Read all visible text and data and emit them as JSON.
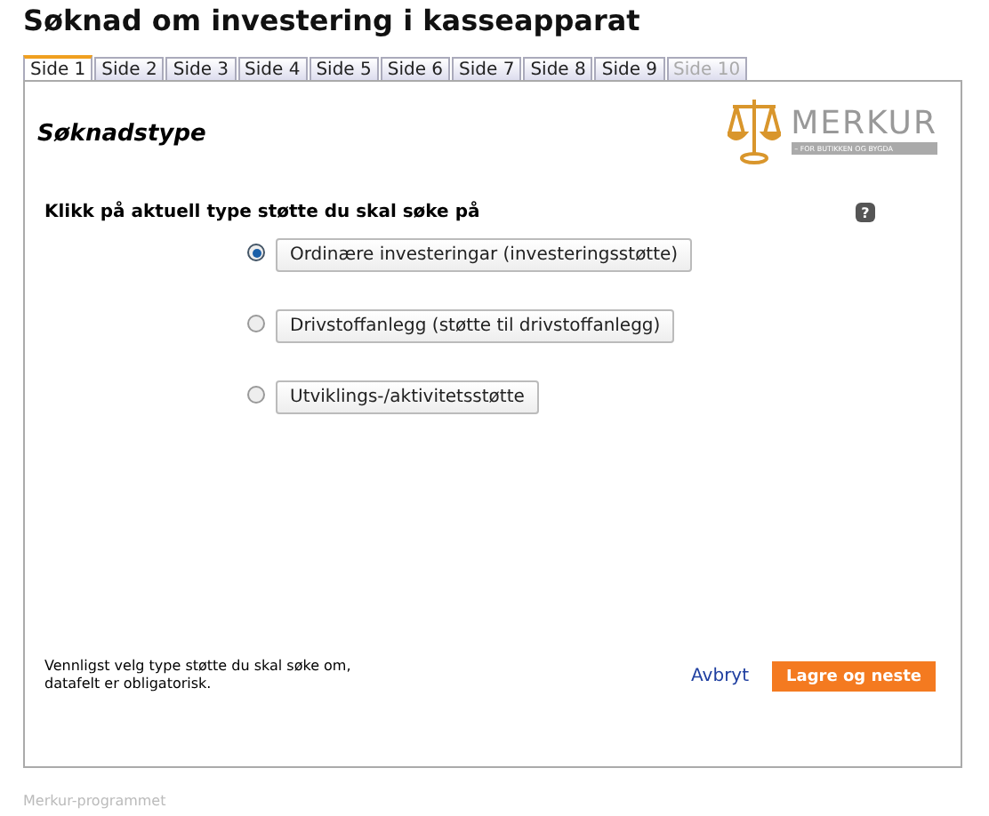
{
  "title": "Søknad om investering i kasseapparat",
  "tabs": [
    {
      "label": "Side 1",
      "selected": true,
      "disabled": false
    },
    {
      "label": "Side 2",
      "selected": false,
      "disabled": false
    },
    {
      "label": "Side 3",
      "selected": false,
      "disabled": false
    },
    {
      "label": "Side 4",
      "selected": false,
      "disabled": false
    },
    {
      "label": "Side 5",
      "selected": false,
      "disabled": false
    },
    {
      "label": "Side 6",
      "selected": false,
      "disabled": false
    },
    {
      "label": "Side 7",
      "selected": false,
      "disabled": false
    },
    {
      "label": "Side 8",
      "selected": false,
      "disabled": false
    },
    {
      "label": "Side 9",
      "selected": false,
      "disabled": false
    },
    {
      "label": "Side 10",
      "selected": false,
      "disabled": true
    }
  ],
  "section_title": "Søknadstype",
  "logo": {
    "name": "MERKUR",
    "tagline": "– FOR BUTIKKEN OG BYGDA"
  },
  "question": "Klikk på aktuell type støtte du skal søke på",
  "help": "?",
  "options": [
    {
      "label": "Ordinære investeringar (investeringsstøtte)",
      "selected": true
    },
    {
      "label": "Drivstoffanlegg (støtte til drivstoffanlegg)",
      "selected": false
    },
    {
      "label": "Utviklings-/aktivitetsstøtte",
      "selected": false
    }
  ],
  "note": "Vennligst velg type støtte du skal søke om, datafelt er obligatorisk.",
  "cancel": "Avbryt",
  "submit": "Lagre og neste",
  "footer": "Merkur-programmet"
}
